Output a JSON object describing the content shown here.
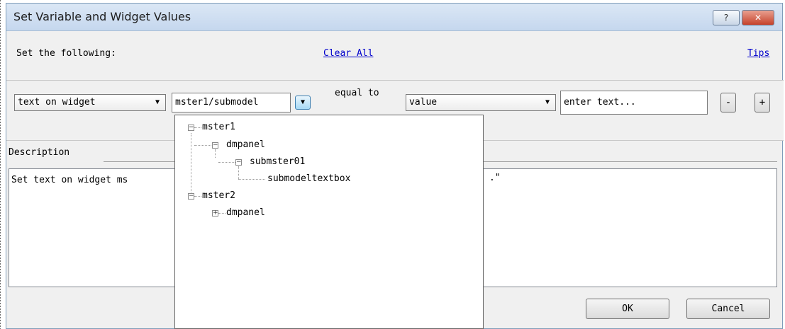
{
  "window": {
    "title": "Set Variable and Widget Values",
    "help_glyph": "?",
    "close_glyph": "✕"
  },
  "header": {
    "prompt": "Set the following:",
    "clear_all": "Clear All",
    "tips": "Tips"
  },
  "row": {
    "target_type": "text on widget",
    "target_path": "mster1/submodel",
    "operator": "equal to",
    "value_type": "value",
    "text_placeholder": "enter text...",
    "minus": "-",
    "plus": "+"
  },
  "description": {
    "tab": "Description",
    "text": "Set text on widget ms",
    "tail": ".\""
  },
  "tree": {
    "nodes": [
      {
        "label": "mster1",
        "expander": "−"
      },
      {
        "label": "dmpanel",
        "expander": "−"
      },
      {
        "label": "submster01",
        "expander": "−"
      },
      {
        "label": "submodeltextbox",
        "expander": ""
      },
      {
        "label": "mster2",
        "expander": "−"
      },
      {
        "label": "dmpanel",
        "expander": "+"
      }
    ]
  },
  "buttons": {
    "ok": "OK",
    "cancel": "Cancel"
  },
  "icons": {
    "dropdown": "chevron-down-icon"
  },
  "colors": {
    "link": "#0000cc",
    "titlebar": "#c5d7ee",
    "close": "#c6412a"
  }
}
